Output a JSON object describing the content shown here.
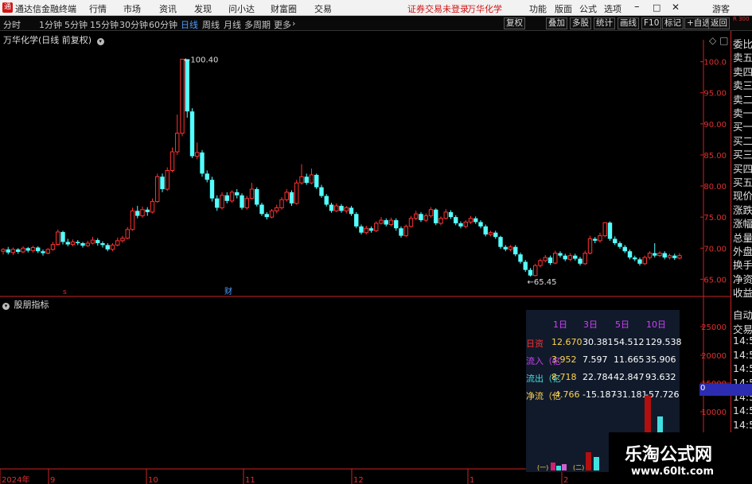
{
  "menu": {
    "app_title": "通达信金融终端",
    "items": [
      "行情",
      "市场",
      "资讯",
      "发现",
      "问小达",
      "财富圈",
      "交易"
    ],
    "notice": "证券交易未登录",
    "stock": "万华化学",
    "right_items": [
      "功能",
      "版面",
      "公式",
      "选项"
    ],
    "user": "游客",
    "icons": [
      "minimize-icon",
      "maximize-icon",
      "close-icon"
    ]
  },
  "timeframes": {
    "items": [
      "分时",
      "1分钟",
      "5分钟",
      "15分钟",
      "30分钟",
      "60分钟",
      "日线",
      "周线",
      "月线",
      "多周期",
      "更多"
    ],
    "active": "日线"
  },
  "toolbar": {
    "buttons": [
      "复权",
      "叠加",
      "多股",
      "统计",
      "画线",
      "F10",
      "标记",
      "+自选",
      "返回"
    ],
    "side_top": "R 300"
  },
  "chart_header": {
    "title": "万华化学(日线 前复权)",
    "indicator": "股朋指标"
  },
  "right_panel": {
    "quotes": [
      "委比",
      "卖五",
      "卖四",
      "卖三",
      "卖二",
      "卖一",
      "买一",
      "买二",
      "买三",
      "买四",
      "买五",
      "现价",
      "涨跌",
      "涨幅",
      "总量",
      "外盘",
      "换手",
      "净资",
      "收益"
    ],
    "lower": [
      "自动",
      "交易",
      "14:56",
      "14:56",
      "14:56",
      "14:56",
      "14:56",
      "14:56",
      "14:56",
      "14:56",
      "14:56"
    ],
    "marker": "0"
  },
  "price_axis": {
    "ticks": [
      "100.0",
      "95.00",
      "90.00",
      "85.00",
      "80.00",
      "75.00",
      "70.00",
      "65.00"
    ]
  },
  "indicator_axis": {
    "ticks": [
      "25000",
      "20000",
      "15000",
      "10000"
    ]
  },
  "annotations": {
    "high": "100.40",
    "low": "65.45",
    "event_s": "s",
    "event_cai": "财"
  },
  "table": {
    "headers": [
      "1日",
      "3日",
      "5日",
      "10日"
    ],
    "rows": [
      {
        "label": "日资",
        "values": [
          "12.670",
          "30.381",
          "54.512",
          "129.538"
        ]
      },
      {
        "label": "流入（亿",
        "values": [
          "3.952",
          "7.597",
          "11.665",
          "35.906"
        ]
      },
      {
        "label": "流出（亿",
        "values": [
          "8.718",
          "22.784",
          "42.847",
          "93.632"
        ]
      },
      {
        "label": "净流（亿",
        "values": [
          "-4.766",
          "-15.187",
          "-31.181",
          "-57.726"
        ]
      }
    ],
    "bar_labels": [
      "(一)",
      "(二)"
    ]
  },
  "x_axis": {
    "labels": [
      "2024年",
      "9",
      "10",
      "11",
      "12",
      "1",
      "2"
    ]
  },
  "watermark": {
    "line1": "乐淘公式网",
    "line2": "www.60lt.com"
  },
  "chart_data": {
    "type": "candlestick",
    "ylim": [
      63,
      102
    ],
    "high_label": 100.4,
    "low_label": 65.45,
    "candles": [
      [
        69.5,
        69.8,
        70,
        69
      ],
      [
        69.8,
        69.3,
        70.2,
        69
      ],
      [
        69.3,
        69.8,
        70.1,
        68.9
      ],
      [
        69.8,
        69.4,
        70,
        69.1
      ],
      [
        69.4,
        70,
        70.3,
        69.2
      ],
      [
        70,
        69.6,
        70.2,
        69.3
      ],
      [
        69.6,
        70.1,
        70.4,
        69.3
      ],
      [
        70.1,
        69.5,
        70.3,
        69.2
      ],
      [
        69.5,
        69.2,
        69.8,
        68.8
      ],
      [
        69.2,
        69.8,
        70,
        69
      ],
      [
        69.8,
        70.6,
        71,
        69.6
      ],
      [
        70.6,
        72.6,
        73,
        70.4
      ],
      [
        72.6,
        71,
        72.8,
        70.6
      ],
      [
        71,
        70.6,
        71.5,
        70.3
      ],
      [
        70.6,
        71,
        71.4,
        70.3
      ],
      [
        71,
        70.8,
        71.3,
        70.5
      ],
      [
        70.8,
        70.4,
        71,
        70.1
      ],
      [
        70.4,
        70.8,
        71.2,
        70.2
      ],
      [
        70.8,
        71.3,
        71.8,
        70.6
      ],
      [
        71.3,
        70.8,
        71.6,
        70.4
      ],
      [
        70.8,
        70.5,
        71.1,
        70.1
      ],
      [
        70.5,
        69.8,
        70.8,
        69.5
      ],
      [
        69.8,
        70.5,
        70.8,
        69.5
      ],
      [
        70.5,
        71.2,
        71.7,
        70.3
      ],
      [
        71.2,
        71.6,
        72,
        70.9
      ],
      [
        71.6,
        73,
        73.4,
        71.4
      ],
      [
        73,
        76,
        76.5,
        72.8
      ],
      [
        76,
        75.2,
        76.8,
        74.8
      ],
      [
        75.2,
        76.2,
        76.7,
        74.9
      ],
      [
        76.2,
        75.8,
        76.6,
        75.2
      ],
      [
        75.8,
        77.5,
        78,
        75.6
      ],
      [
        77.5,
        81.5,
        82,
        77.3
      ],
      [
        81.5,
        79.5,
        82,
        79
      ],
      [
        79.5,
        82.5,
        83,
        79.2
      ],
      [
        82.5,
        85.5,
        86.2,
        82.2
      ],
      [
        85.5,
        88.5,
        91.5,
        85
      ],
      [
        88.5,
        100.4,
        100.4,
        88
      ],
      [
        100.4,
        92,
        100.4,
        91
      ],
      [
        92,
        84.8,
        92.5,
        84.5
      ],
      [
        84.8,
        85.4,
        87,
        84.3
      ],
      [
        85.4,
        82,
        85.8,
        81.5
      ],
      [
        82,
        81,
        82.5,
        80.6
      ],
      [
        81,
        78,
        81.5,
        77.5
      ],
      [
        78,
        76.5,
        78.5,
        76
      ],
      [
        76.5,
        78.5,
        79,
        76.2
      ],
      [
        78.5,
        77.6,
        79,
        77.2
      ],
      [
        77.6,
        79,
        79.3,
        77.3
      ],
      [
        79,
        78.5,
        79.5,
        78
      ],
      [
        78.5,
        76.5,
        78.8,
        76.2
      ],
      [
        76.5,
        78,
        78.4,
        76.2
      ],
      [
        78,
        79.5,
        80.5,
        77.8
      ],
      [
        79.5,
        77,
        79.8,
        76.7
      ],
      [
        77,
        75.5,
        77.3,
        75.2
      ],
      [
        75.5,
        75,
        75.8,
        74.6
      ],
      [
        75,
        76,
        76.3,
        74.8
      ],
      [
        76,
        76.5,
        77,
        75.6
      ],
      [
        76.5,
        77.8,
        78.2,
        76.2
      ],
      [
        77.8,
        79,
        79.5,
        77.5
      ],
      [
        79,
        77.2,
        79.3,
        76.8
      ],
      [
        77.2,
        80.5,
        81,
        77
      ],
      [
        80.5,
        81.5,
        83.5,
        80.2
      ],
      [
        81.5,
        80.5,
        82,
        80.2
      ],
      [
        80.5,
        81.8,
        82.8,
        80.3
      ],
      [
        81.8,
        79.8,
        82,
        79.5
      ],
      [
        79.8,
        78.4,
        80.2,
        78.1
      ],
      [
        78.4,
        77,
        78.7,
        76.7
      ],
      [
        77,
        76,
        77.3,
        75.7
      ],
      [
        76,
        76.8,
        77.2,
        75.8
      ],
      [
        76.8,
        76,
        77.1,
        75.7
      ],
      [
        76,
        76.5,
        76.8,
        75.6
      ],
      [
        76.5,
        75.5,
        76.8,
        75.2
      ],
      [
        75.5,
        73.5,
        75.8,
        73.2
      ],
      [
        73.5,
        72.5,
        73.8,
        72.2
      ],
      [
        72.5,
        73.2,
        73.6,
        72.2
      ],
      [
        73.2,
        72.8,
        73.5,
        72.5
      ],
      [
        72.8,
        74,
        74.3,
        72.6
      ],
      [
        74,
        74.5,
        75,
        73.8
      ],
      [
        74.5,
        73.8,
        74.8,
        73.5
      ],
      [
        73.8,
        74.5,
        74.9,
        73.5
      ],
      [
        74.5,
        73.2,
        74.8,
        72.8
      ],
      [
        73.2,
        72,
        73.5,
        71.7
      ],
      [
        72,
        73.5,
        73.8,
        71.8
      ],
      [
        73.5,
        74.8,
        75.2,
        73.3
      ],
      [
        74.8,
        75.5,
        76,
        74.5
      ],
      [
        75.5,
        74.5,
        75.8,
        74.2
      ],
      [
        74.5,
        75.2,
        75.6,
        74.2
      ],
      [
        75.2,
        76.2,
        76.6,
        74.9
      ],
      [
        76.2,
        74,
        76.4,
        73.7
      ],
      [
        74,
        74.8,
        75.1,
        73.7
      ],
      [
        74.8,
        75.8,
        76.3,
        74.6
      ],
      [
        75.8,
        75,
        76.1,
        74.7
      ],
      [
        75,
        74,
        75.3,
        73.7
      ],
      [
        74,
        73.5,
        74.3,
        73.2
      ],
      [
        73.5,
        74.2,
        74.5,
        73.2
      ],
      [
        74.2,
        74.8,
        75.2,
        73.9
      ],
      [
        74.8,
        74.2,
        75.1,
        73.9
      ],
      [
        74.2,
        73.5,
        74.5,
        73.2
      ],
      [
        73.5,
        72.2,
        73.8,
        71.9
      ],
      [
        72.2,
        72.5,
        72.8,
        71.9
      ],
      [
        72.5,
        71.8,
        72.8,
        71.5
      ],
      [
        71.8,
        70.2,
        72,
        69.9
      ],
      [
        70.2,
        69.8,
        70.5,
        69.5
      ],
      [
        69.8,
        70.2,
        70.5,
        69.5
      ],
      [
        70.2,
        69,
        70.5,
        68.7
      ],
      [
        69,
        67.8,
        69.3,
        67.5
      ],
      [
        67.8,
        66.5,
        68.1,
        66.2
      ],
      [
        66.5,
        65.6,
        66.8,
        65.45
      ],
      [
        65.6,
        67.2,
        67.5,
        65.45
      ],
      [
        67.2,
        68,
        68.3,
        66.9
      ],
      [
        68,
        68.5,
        68.9,
        67.7
      ],
      [
        68.5,
        67.6,
        68.8,
        67.3
      ],
      [
        67.6,
        69.2,
        69.6,
        67.4
      ],
      [
        69.2,
        68.8,
        69.5,
        68.5
      ],
      [
        68.8,
        68.2,
        69.1,
        67.9
      ],
      [
        68.2,
        68.8,
        69.2,
        67.9
      ],
      [
        68.8,
        68.3,
        69.1,
        68
      ],
      [
        68.3,
        67.5,
        68.6,
        67.2
      ],
      [
        67.5,
        69.2,
        69.6,
        67.3
      ],
      [
        69.2,
        71.5,
        72,
        69
      ],
      [
        71.5,
        71.2,
        71.8,
        70.8
      ],
      [
        71.2,
        72,
        72.5,
        70.9
      ],
      [
        72,
        74.1,
        74.2,
        71.8
      ],
      [
        74.1,
        71.5,
        74.3,
        71.2
      ],
      [
        71.5,
        70.8,
        71.9,
        70.5
      ],
      [
        70.8,
        70.2,
        71.1,
        69.9
      ],
      [
        70.2,
        69.5,
        70.5,
        69.2
      ],
      [
        69.5,
        68.5,
        69.8,
        68.2
      ],
      [
        68.5,
        68.2,
        68.8,
        67.9
      ],
      [
        68.2,
        67.5,
        68.5,
        67.2
      ],
      [
        67.5,
        68.5,
        68.8,
        67.3
      ],
      [
        68.5,
        69.2,
        69.5,
        68.2
      ],
      [
        69.2,
        68.8,
        70.8,
        68.5
      ],
      [
        68.8,
        69.2,
        69.5,
        68.6
      ],
      [
        69.2,
        68.5,
        69.5,
        68.2
      ],
      [
        68.5,
        68.8,
        69.1,
        68.2
      ],
      [
        68.8,
        68.4,
        69.1,
        68.1
      ],
      [
        68.4,
        68.8,
        69.2,
        68.2
      ]
    ]
  }
}
